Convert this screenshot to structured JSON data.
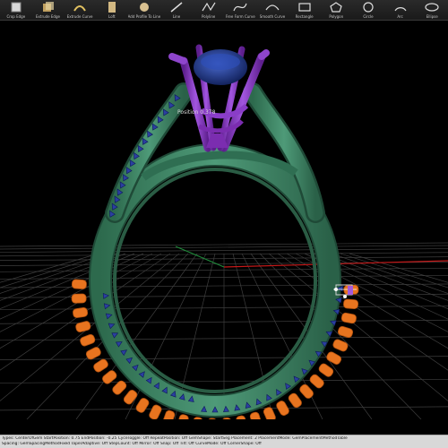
{
  "toolbar": {
    "tools": [
      {
        "label": "Crop Edge",
        "icon": "crop-edge-icon"
      },
      {
        "label": "Extrude Edge",
        "icon": "extrude-edge-icon"
      },
      {
        "label": "Extrude Curve",
        "icon": "extrude-curve-icon"
      },
      {
        "label": "Loft",
        "icon": "loft-icon"
      },
      {
        "label": "Add Profile To Line",
        "icon": "add-profile-icon"
      },
      {
        "label": "Line",
        "icon": "line-icon"
      },
      {
        "label": "Polyline",
        "icon": "polyline-icon"
      },
      {
        "label": "Free Form Curve",
        "icon": "freeform-curve-icon"
      },
      {
        "label": "Smooth Curve",
        "icon": "smooth-curve-icon"
      },
      {
        "label": "Rectangle",
        "icon": "rectangle-icon"
      },
      {
        "label": "Polygon",
        "icon": "polygon-icon"
      },
      {
        "label": "Circle",
        "icon": "circle-icon"
      },
      {
        "label": "Arc",
        "icon": "arc-icon"
      },
      {
        "label": "Ellipse",
        "icon": "ellipse-icon"
      }
    ]
  },
  "viewport": {
    "overlay_label": "Position 0.378"
  },
  "status": {
    "line1": "Types: CenterOfGem  StartPosition: 0.75  EndPosition: -0.25  CyceToggle: Off  RepeatPosition: Off  GemShape: StartSeg  Placement: 2  PlacementMode: GemPlacementMethodTable",
    "line2": "Spacing: GemSpacingMethodFixed  TaperAdaptive: Off  StepCount: Off  Mirror: Off  Snap: Off  Tilt: Off  CurveMode: Off  CornerShape: Off"
  },
  "colors": {
    "shank": "#3a7e5e",
    "prongs": "#7b2db0",
    "gem": "#1e3a8a",
    "pave": "#2b3fa0",
    "scallop": "#e8741f",
    "grid": "#3e3e3e",
    "axis_x": "#c41818",
    "axis_y": "#1f8a3a"
  }
}
